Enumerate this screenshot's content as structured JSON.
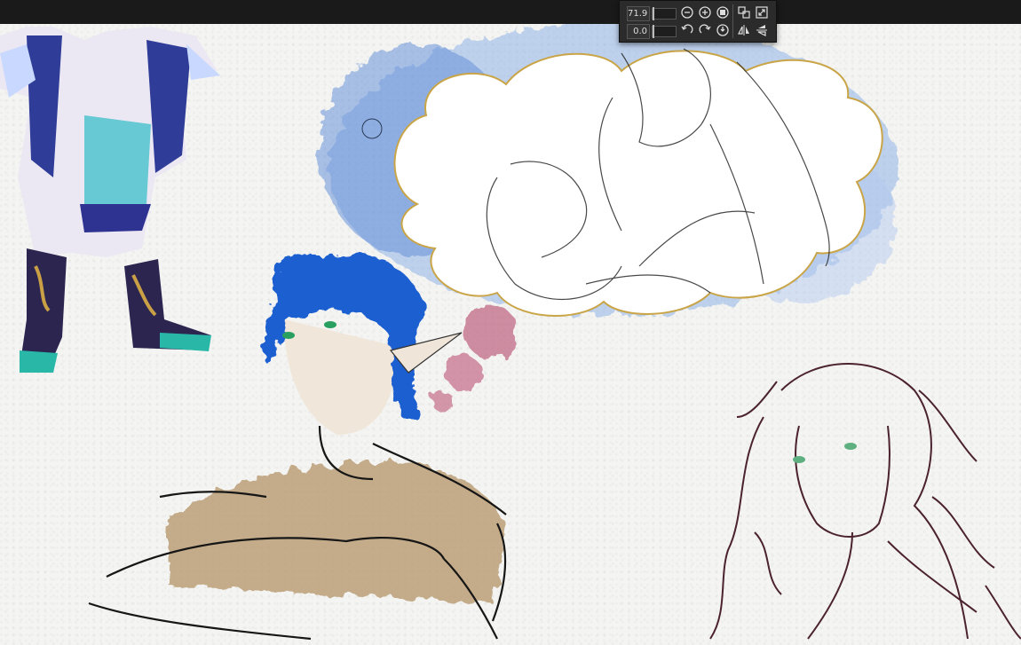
{
  "view_controls": {
    "zoom_value": "71.9",
    "rotation_value": "0.0"
  },
  "icons": {
    "zoom_out": "zoom-out-icon",
    "zoom_in": "zoom-in-icon",
    "fit": "fit-view-icon",
    "actual_size": "actual-size-icon",
    "fullscreen": "fullscreen-icon",
    "rotate_left": "rotate-left-icon",
    "rotate_right": "rotate-right-icon",
    "reset_rotation": "reset-rotation-icon",
    "flip_horizontal": "flip-horizontal-icon",
    "flip_vertical": "flip-vertical-icon"
  },
  "colors": {
    "toolbar_bg": "#1a1a1a",
    "panel_bg": "#2b2b2b",
    "paper": "#f4f4f2",
    "watercolor_blue": "#6f9ee0",
    "hair_blue": "#1f5fd0",
    "skin_tan": "#b8996a",
    "bubble_pink": "#b24a68"
  }
}
